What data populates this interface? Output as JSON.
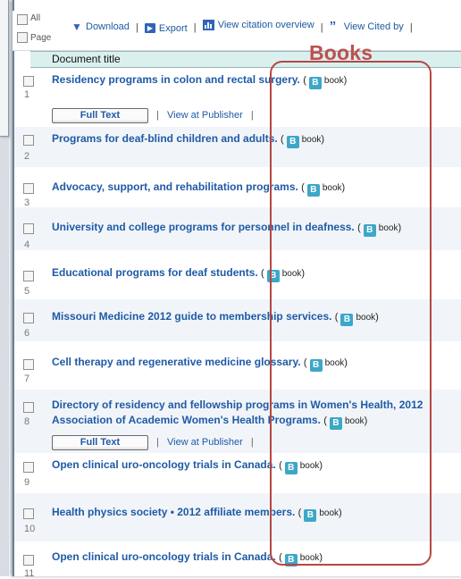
{
  "toolbar": {
    "all_label": "All",
    "page_label": "Page",
    "download_label": "Download",
    "export_label": "Export",
    "citation_label": "View citation overview",
    "cited_by_label": "View Cited by",
    "separator": "|"
  },
  "table": {
    "header_title": "Document title"
  },
  "annotation": {
    "label": "Books",
    "color": "#c0504d"
  },
  "badge": {
    "letter": "B",
    "text": "book"
  },
  "full_text_label": "Full Text",
  "view_publisher_label": "View at Publisher",
  "rows": [
    {
      "num": "1",
      "title": "Residency programs in colon and rectal surgery."
    },
    {
      "num": "2",
      "title": "Programs for deaf-blind children and adults."
    },
    {
      "num": "3",
      "title": "Advocacy, support, and rehabilitation programs."
    },
    {
      "num": "4",
      "title": "University and college programs for personnel in deafness."
    },
    {
      "num": "5",
      "title": "Educational programs for deaf students."
    },
    {
      "num": "6",
      "title": "Missouri Medicine 2012 guide to membership services."
    },
    {
      "num": "7",
      "title": "Cell therapy and regenerative medicine glossary."
    },
    {
      "num": "8",
      "title": "Directory of residency and fellowship programs in Women's Health, 2012",
      "title2": "Association of Academic Women's Health Programs."
    },
    {
      "num": "9",
      "title": "Open clinical uro-oncology trials in Canada."
    },
    {
      "num": "10",
      "title": "Health physics society • 2012 affiliate members."
    },
    {
      "num": "11",
      "title": "Open clinical uro-oncology trials in Canada."
    }
  ]
}
